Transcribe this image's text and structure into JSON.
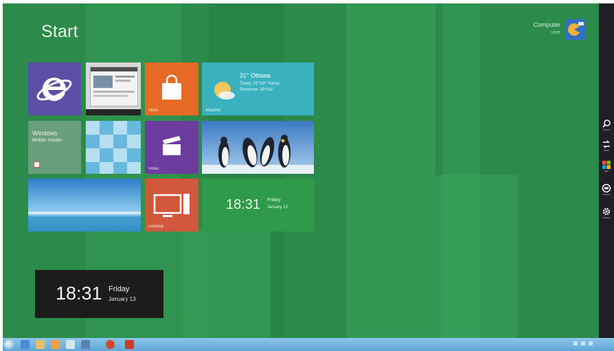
{
  "start": {
    "title": "Start"
  },
  "user": {
    "name": "Computer",
    "sub": "user"
  },
  "tiles": {
    "weather": {
      "temp": "31° Ottawa",
      "l1": "Today: 31°/19° Sunny",
      "l2": "Tomorrow: 30°/18°",
      "label": "Weather"
    },
    "messaging": {
      "title": "Windows",
      "sub": "Mobile Insider"
    },
    "store": {
      "label": "Store"
    },
    "video": {
      "label": "Video"
    },
    "desktop": {
      "label": "Desktop"
    },
    "clock": {
      "time": "18:31",
      "day": "Friday",
      "date": "January 13"
    }
  },
  "lock_clock": {
    "time": "18:31",
    "day": "Friday",
    "date": "January 13"
  },
  "charms": {
    "search": "Search",
    "share": "Share",
    "start": "Start",
    "devices": "Devices",
    "settings": "Settings"
  },
  "colors": {
    "background": "#2c8a4a",
    "ie": "#5c4ea6",
    "store": "#e76a24",
    "weather": "#3ab1bf",
    "video": "#6c3b9e",
    "desktop": "#d2573b",
    "taskbar": "#7bbbe3"
  },
  "icons": [
    "internet-explorer-icon",
    "store-bag-icon",
    "weather-sun-icon",
    "clapperboard-icon",
    "desktop-monitor-icon",
    "search-icon",
    "share-icon",
    "windows-icon",
    "devices-icon",
    "gear-icon"
  ]
}
